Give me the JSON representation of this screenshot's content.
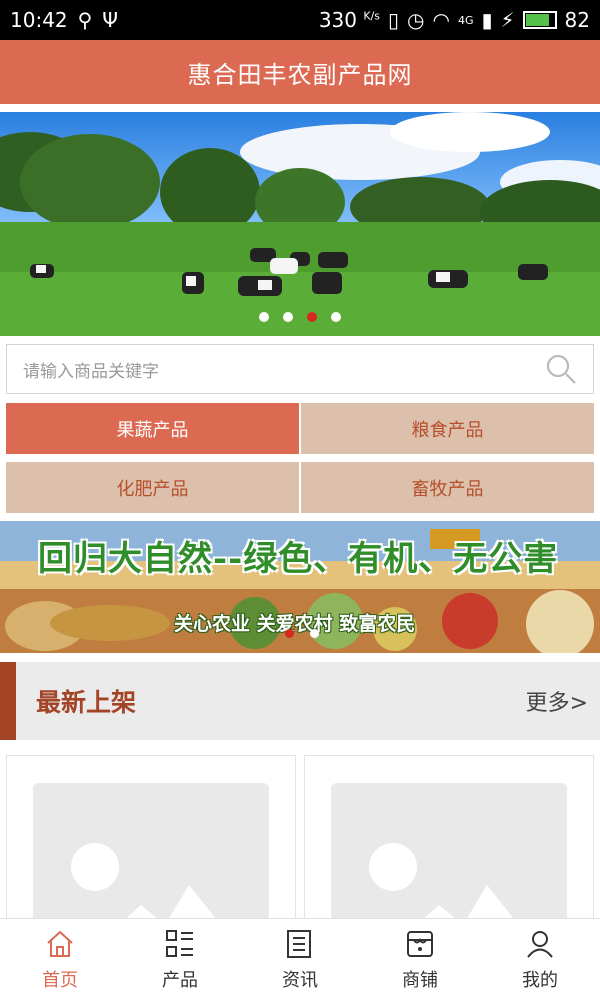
{
  "status": {
    "time": "10:42",
    "network_speed": "330",
    "speed_unit": "K/s",
    "battery": "82",
    "signal_type": "4G"
  },
  "header": {
    "title": "惠合田丰农副产品网"
  },
  "search": {
    "placeholder": "请输入商品关键字"
  },
  "categories": [
    {
      "label": "果蔬产品",
      "active": true
    },
    {
      "label": "粮食产品",
      "active": false
    },
    {
      "label": "化肥产品",
      "active": false
    },
    {
      "label": "畜牧产品",
      "active": false
    }
  ],
  "banner": {
    "title": "回归大自然--绿色、有机、无公害",
    "subtitle": "关心农业 关爱农村 致富农民"
  },
  "section": {
    "title": "最新上架",
    "more": "更多>"
  },
  "tabs": [
    {
      "label": "首页",
      "icon": "home-icon"
    },
    {
      "label": "产品",
      "icon": "product-grid-icon"
    },
    {
      "label": "资讯",
      "icon": "news-icon"
    },
    {
      "label": "商铺",
      "icon": "shop-icon"
    },
    {
      "label": "我的",
      "icon": "user-icon"
    }
  ],
  "colors": {
    "brand": "#dc6a53",
    "category_bg": "#ddc0ab",
    "section_accent": "#a34427"
  }
}
